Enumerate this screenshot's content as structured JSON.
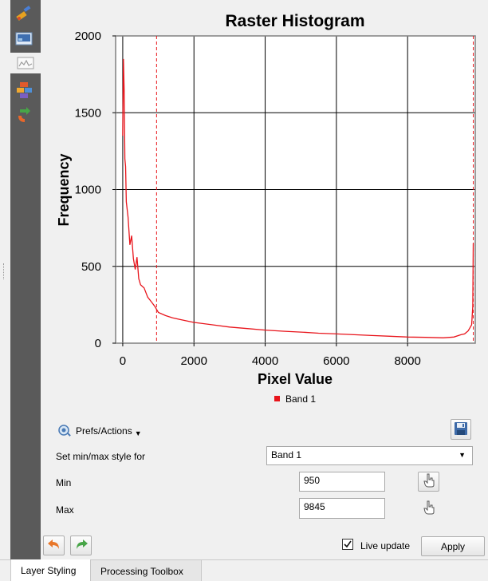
{
  "toolstrip": {
    "items": [
      "paintbrush-icon",
      "raster-info-icon",
      "histogram-icon",
      "layer-style-icon",
      "history-icon"
    ]
  },
  "chart_data": {
    "type": "line",
    "title": "Raster Histogram",
    "xlabel": "Pixel Value",
    "ylabel": "Frequency",
    "xlim": [
      -200,
      9900
    ],
    "ylim": [
      0,
      2000
    ],
    "xticks": [
      0,
      2000,
      4000,
      6000,
      8000
    ],
    "yticks": [
      0,
      500,
      1000,
      1500,
      2000
    ],
    "grid": true,
    "legend_position": "bottom",
    "min_marker": 950,
    "max_marker": 9845,
    "series": [
      {
        "name": "Band 1",
        "color": "#e8141b",
        "x": [
          0,
          20,
          40,
          60,
          80,
          100,
          150,
          200,
          250,
          300,
          350,
          400,
          450,
          500,
          600,
          700,
          800,
          900,
          1000,
          1200,
          1400,
          1600,
          1800,
          2000,
          2500,
          3000,
          3500,
          4000,
          4500,
          5000,
          5500,
          6000,
          6500,
          7000,
          7500,
          8000,
          8500,
          9000,
          9300,
          9500,
          9600,
          9700,
          9750,
          9800,
          9830,
          9845
        ],
        "y": [
          1350,
          1850,
          1650,
          1200,
          1150,
          920,
          820,
          640,
          700,
          550,
          480,
          560,
          420,
          380,
          360,
          300,
          270,
          240,
          200,
          180,
          165,
          155,
          145,
          135,
          120,
          105,
          95,
          85,
          78,
          72,
          65,
          60,
          55,
          50,
          45,
          40,
          38,
          35,
          40,
          55,
          60,
          80,
          100,
          120,
          240,
          650
        ]
      }
    ]
  },
  "controls": {
    "prefs_label": "Prefs/Actions",
    "minmax_style_label": "Set min/max style for",
    "band_selected": "Band 1",
    "min_label": "Min",
    "min_value": "950",
    "max_label": "Max",
    "max_value": "9845",
    "live_update_label": "Live update",
    "live_update_checked": true,
    "apply_label": "Apply"
  },
  "tabs": [
    {
      "label": "Layer Styling",
      "active": true
    },
    {
      "label": "Processing Toolbox",
      "active": false
    }
  ]
}
